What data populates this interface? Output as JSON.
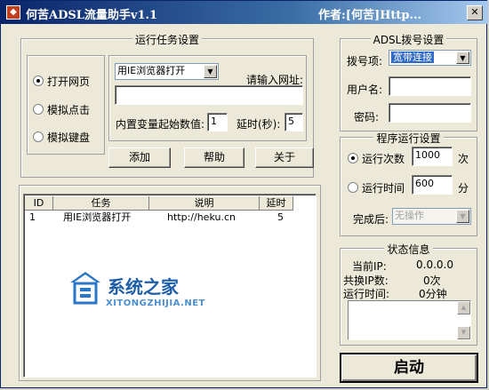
{
  "window": {
    "title": "何苦ADSL流量助手v1.1",
    "author": "作者:[何苦]Http...",
    "close_glyph": "✕"
  },
  "task_settings": {
    "legend": "运行任务设置",
    "modes": [
      {
        "label": "打开网页",
        "selected": true
      },
      {
        "label": "模拟点击",
        "selected": false
      },
      {
        "label": "模拟键盘",
        "selected": false
      }
    ],
    "browser_select": "用IE浏览器打开",
    "url_label": "请输入网址:",
    "url_value": "",
    "var_start_label": "内置变量起始数值:",
    "var_start_value": "1",
    "delay_label": "延时(秒):",
    "delay_value": "5",
    "buttons": {
      "add": "添加",
      "help": "帮助",
      "about": "关于"
    }
  },
  "task_list": {
    "columns": [
      "ID",
      "任务",
      "说明",
      "延时"
    ],
    "rows": [
      {
        "id": "1",
        "task": "用IE浏览器打开",
        "desc": "http://heku.cn",
        "delay": "5"
      }
    ]
  },
  "watermark": {
    "title": "系统之家",
    "sub": "XITONGZHIJIA.NET"
  },
  "adsl": {
    "legend": "ADSL拨号设置",
    "dial_label": "拨号项:",
    "dial_value": "宽带连接",
    "user_label": "用户名:",
    "user_value": "",
    "pass_label": "密码:",
    "pass_value": ""
  },
  "run_settings": {
    "legend": "程序运行设置",
    "count_label": "运行次数",
    "count_value": "1000",
    "count_unit": "次",
    "time_label": "运行时间",
    "time_value": "600",
    "time_unit": "分",
    "mode": "count",
    "after_label": "完成后:",
    "after_value": "无操作"
  },
  "status": {
    "legend": "状态信息",
    "ip_label": "当前IP:",
    "ip_value": "0.0.0.0",
    "shared_label": "共换IP数:",
    "shared_value": "0次",
    "runtime_label": "运行时间:",
    "runtime_value": "0分钟"
  },
  "start_button": "启动"
}
